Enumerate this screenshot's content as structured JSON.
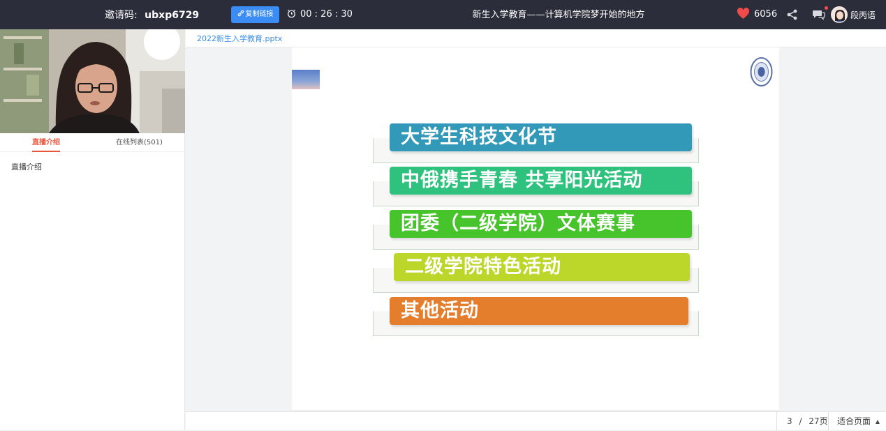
{
  "topbar": {
    "invite_label": "邀请码:",
    "invite_code": "ubxp6729",
    "copy_link_label": "复制链接",
    "timer": "00 : 26 : 30",
    "title": "新生入学教育——计算机学院梦开始的地方",
    "likes": "6056",
    "user_name": "段丙语"
  },
  "left_panel": {
    "tabs": [
      {
        "label": "直播介绍",
        "active": true
      },
      {
        "label": "在线列表(501)",
        "active": false
      }
    ],
    "intro_text": "直播介绍"
  },
  "main": {
    "filename": "2022新生入学教育.pptx",
    "slide_items": [
      {
        "label": "大学生科技文化节",
        "color": "#3399b8"
      },
      {
        "label": "中俄携手青春 共享阳光活动",
        "color": "#2ec27e"
      },
      {
        "label": "团委（二级学院）文体赛事",
        "color": "#47c42c"
      },
      {
        "label": "二级学院特色活动",
        "color": "#bcd62a"
      },
      {
        "label": "其他活动",
        "color": "#e47d2c"
      }
    ],
    "pager": {
      "current": "3",
      "sep": "/",
      "total": "27页"
    },
    "fit_label": "适合页面"
  }
}
